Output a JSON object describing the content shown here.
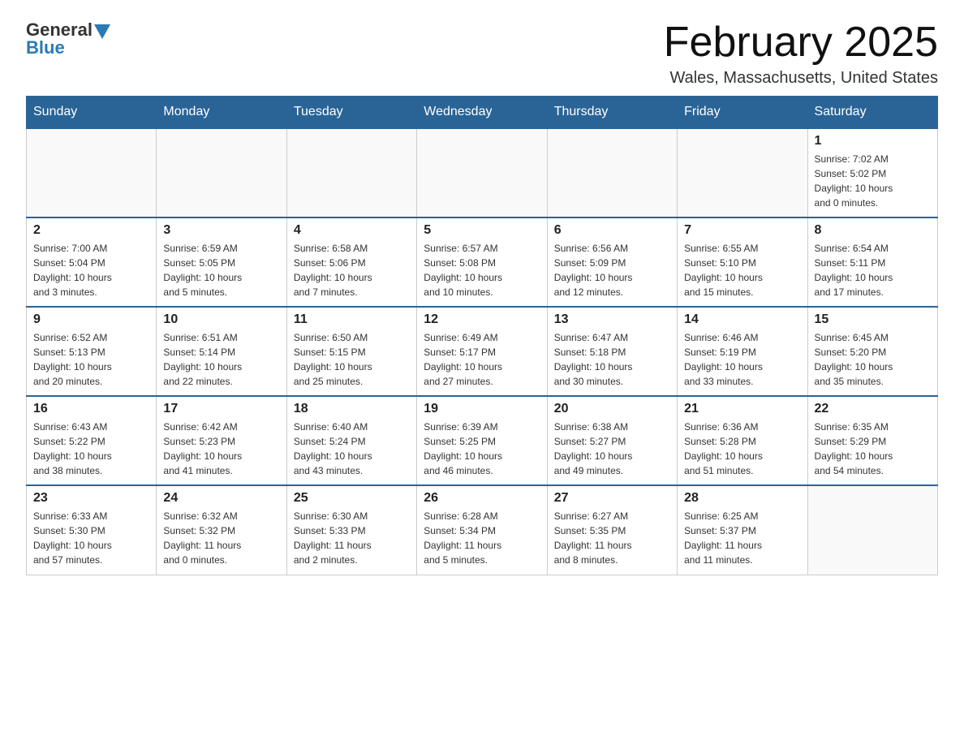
{
  "header": {
    "logo_general": "General",
    "logo_blue": "Blue",
    "month_title": "February 2025",
    "location": "Wales, Massachusetts, United States"
  },
  "weekdays": [
    "Sunday",
    "Monday",
    "Tuesday",
    "Wednesday",
    "Thursday",
    "Friday",
    "Saturday"
  ],
  "weeks": [
    [
      {
        "day": "",
        "info": ""
      },
      {
        "day": "",
        "info": ""
      },
      {
        "day": "",
        "info": ""
      },
      {
        "day": "",
        "info": ""
      },
      {
        "day": "",
        "info": ""
      },
      {
        "day": "",
        "info": ""
      },
      {
        "day": "1",
        "info": "Sunrise: 7:02 AM\nSunset: 5:02 PM\nDaylight: 10 hours\nand 0 minutes."
      }
    ],
    [
      {
        "day": "2",
        "info": "Sunrise: 7:00 AM\nSunset: 5:04 PM\nDaylight: 10 hours\nand 3 minutes."
      },
      {
        "day": "3",
        "info": "Sunrise: 6:59 AM\nSunset: 5:05 PM\nDaylight: 10 hours\nand 5 minutes."
      },
      {
        "day": "4",
        "info": "Sunrise: 6:58 AM\nSunset: 5:06 PM\nDaylight: 10 hours\nand 7 minutes."
      },
      {
        "day": "5",
        "info": "Sunrise: 6:57 AM\nSunset: 5:08 PM\nDaylight: 10 hours\nand 10 minutes."
      },
      {
        "day": "6",
        "info": "Sunrise: 6:56 AM\nSunset: 5:09 PM\nDaylight: 10 hours\nand 12 minutes."
      },
      {
        "day": "7",
        "info": "Sunrise: 6:55 AM\nSunset: 5:10 PM\nDaylight: 10 hours\nand 15 minutes."
      },
      {
        "day": "8",
        "info": "Sunrise: 6:54 AM\nSunset: 5:11 PM\nDaylight: 10 hours\nand 17 minutes."
      }
    ],
    [
      {
        "day": "9",
        "info": "Sunrise: 6:52 AM\nSunset: 5:13 PM\nDaylight: 10 hours\nand 20 minutes."
      },
      {
        "day": "10",
        "info": "Sunrise: 6:51 AM\nSunset: 5:14 PM\nDaylight: 10 hours\nand 22 minutes."
      },
      {
        "day": "11",
        "info": "Sunrise: 6:50 AM\nSunset: 5:15 PM\nDaylight: 10 hours\nand 25 minutes."
      },
      {
        "day": "12",
        "info": "Sunrise: 6:49 AM\nSunset: 5:17 PM\nDaylight: 10 hours\nand 27 minutes."
      },
      {
        "day": "13",
        "info": "Sunrise: 6:47 AM\nSunset: 5:18 PM\nDaylight: 10 hours\nand 30 minutes."
      },
      {
        "day": "14",
        "info": "Sunrise: 6:46 AM\nSunset: 5:19 PM\nDaylight: 10 hours\nand 33 minutes."
      },
      {
        "day": "15",
        "info": "Sunrise: 6:45 AM\nSunset: 5:20 PM\nDaylight: 10 hours\nand 35 minutes."
      }
    ],
    [
      {
        "day": "16",
        "info": "Sunrise: 6:43 AM\nSunset: 5:22 PM\nDaylight: 10 hours\nand 38 minutes."
      },
      {
        "day": "17",
        "info": "Sunrise: 6:42 AM\nSunset: 5:23 PM\nDaylight: 10 hours\nand 41 minutes."
      },
      {
        "day": "18",
        "info": "Sunrise: 6:40 AM\nSunset: 5:24 PM\nDaylight: 10 hours\nand 43 minutes."
      },
      {
        "day": "19",
        "info": "Sunrise: 6:39 AM\nSunset: 5:25 PM\nDaylight: 10 hours\nand 46 minutes."
      },
      {
        "day": "20",
        "info": "Sunrise: 6:38 AM\nSunset: 5:27 PM\nDaylight: 10 hours\nand 49 minutes."
      },
      {
        "day": "21",
        "info": "Sunrise: 6:36 AM\nSunset: 5:28 PM\nDaylight: 10 hours\nand 51 minutes."
      },
      {
        "day": "22",
        "info": "Sunrise: 6:35 AM\nSunset: 5:29 PM\nDaylight: 10 hours\nand 54 minutes."
      }
    ],
    [
      {
        "day": "23",
        "info": "Sunrise: 6:33 AM\nSunset: 5:30 PM\nDaylight: 10 hours\nand 57 minutes."
      },
      {
        "day": "24",
        "info": "Sunrise: 6:32 AM\nSunset: 5:32 PM\nDaylight: 11 hours\nand 0 minutes."
      },
      {
        "day": "25",
        "info": "Sunrise: 6:30 AM\nSunset: 5:33 PM\nDaylight: 11 hours\nand 2 minutes."
      },
      {
        "day": "26",
        "info": "Sunrise: 6:28 AM\nSunset: 5:34 PM\nDaylight: 11 hours\nand 5 minutes."
      },
      {
        "day": "27",
        "info": "Sunrise: 6:27 AM\nSunset: 5:35 PM\nDaylight: 11 hours\nand 8 minutes."
      },
      {
        "day": "28",
        "info": "Sunrise: 6:25 AM\nSunset: 5:37 PM\nDaylight: 11 hours\nand 11 minutes."
      },
      {
        "day": "",
        "info": ""
      }
    ]
  ]
}
